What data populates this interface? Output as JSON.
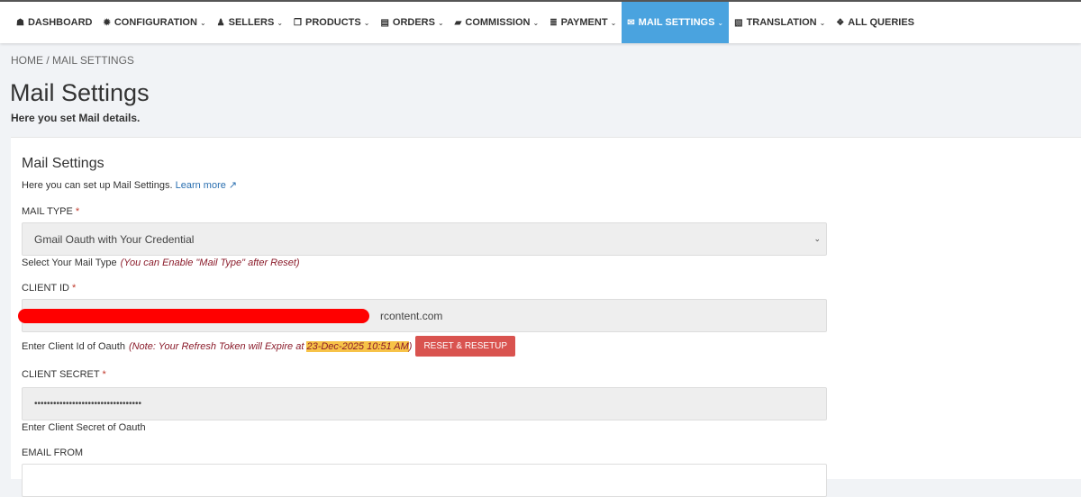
{
  "nav": [
    {
      "label": "DASHBOARD",
      "icon": "dashboard-icon",
      "glyph": "☗",
      "chev": false
    },
    {
      "label": "CONFIGURATION",
      "icon": "gear-icon",
      "glyph": "✹",
      "chev": true
    },
    {
      "label": "SELLERS",
      "icon": "user-icon",
      "glyph": "♟",
      "chev": true
    },
    {
      "label": "PRODUCTS",
      "icon": "product-icon",
      "glyph": "❐",
      "chev": true
    },
    {
      "label": "ORDERS",
      "icon": "orders-icon",
      "glyph": "▤",
      "chev": true
    },
    {
      "label": "COMMISSION",
      "icon": "money-icon",
      "glyph": "▰",
      "chev": true
    },
    {
      "label": "PAYMENT",
      "icon": "payment-icon",
      "glyph": "≣",
      "chev": true
    },
    {
      "label": "MAIL SETTINGS",
      "icon": "envelope-open-icon",
      "glyph": "✉",
      "chev": true,
      "active": true
    },
    {
      "label": "TRANSLATION",
      "icon": "language-icon",
      "glyph": "▧",
      "chev": true
    },
    {
      "label": "ALL QUERIES",
      "icon": "comments-icon",
      "glyph": "❖",
      "chev": false
    }
  ],
  "breadcrumb": "HOME / MAIL SETTINGS",
  "page_title": "Mail Settings",
  "page_subtitle": "Here you set Mail details.",
  "card": {
    "title": "Mail Settings",
    "desc": "Here you can set up Mail Settings.",
    "learn_more": "Learn more ↗"
  },
  "mail_type": {
    "label": "MAIL TYPE",
    "req": "*",
    "value": "Gmail Oauth with Your Credential",
    "help": "Select Your Mail Type",
    "note": "(You can Enable \"Mail Type\" after Reset)"
  },
  "client_id": {
    "label": "CLIENT ID",
    "req": "*",
    "value": "rcontent.com",
    "help": "Enter Client Id of Oauth",
    "note": "(Note: Your Refresh Token will Expire at",
    "expiry": "23-Dec-2025 10:51 AM",
    "note_end": ")",
    "button": "RESET & RESETUP"
  },
  "client_secret": {
    "label": "CLIENT SECRET",
    "req": "*",
    "value": "••••••••••••••••••••••••••••••••••",
    "help": "Enter Client Secret of Oauth"
  },
  "email_from": {
    "label": "EMAIL FROM"
  }
}
